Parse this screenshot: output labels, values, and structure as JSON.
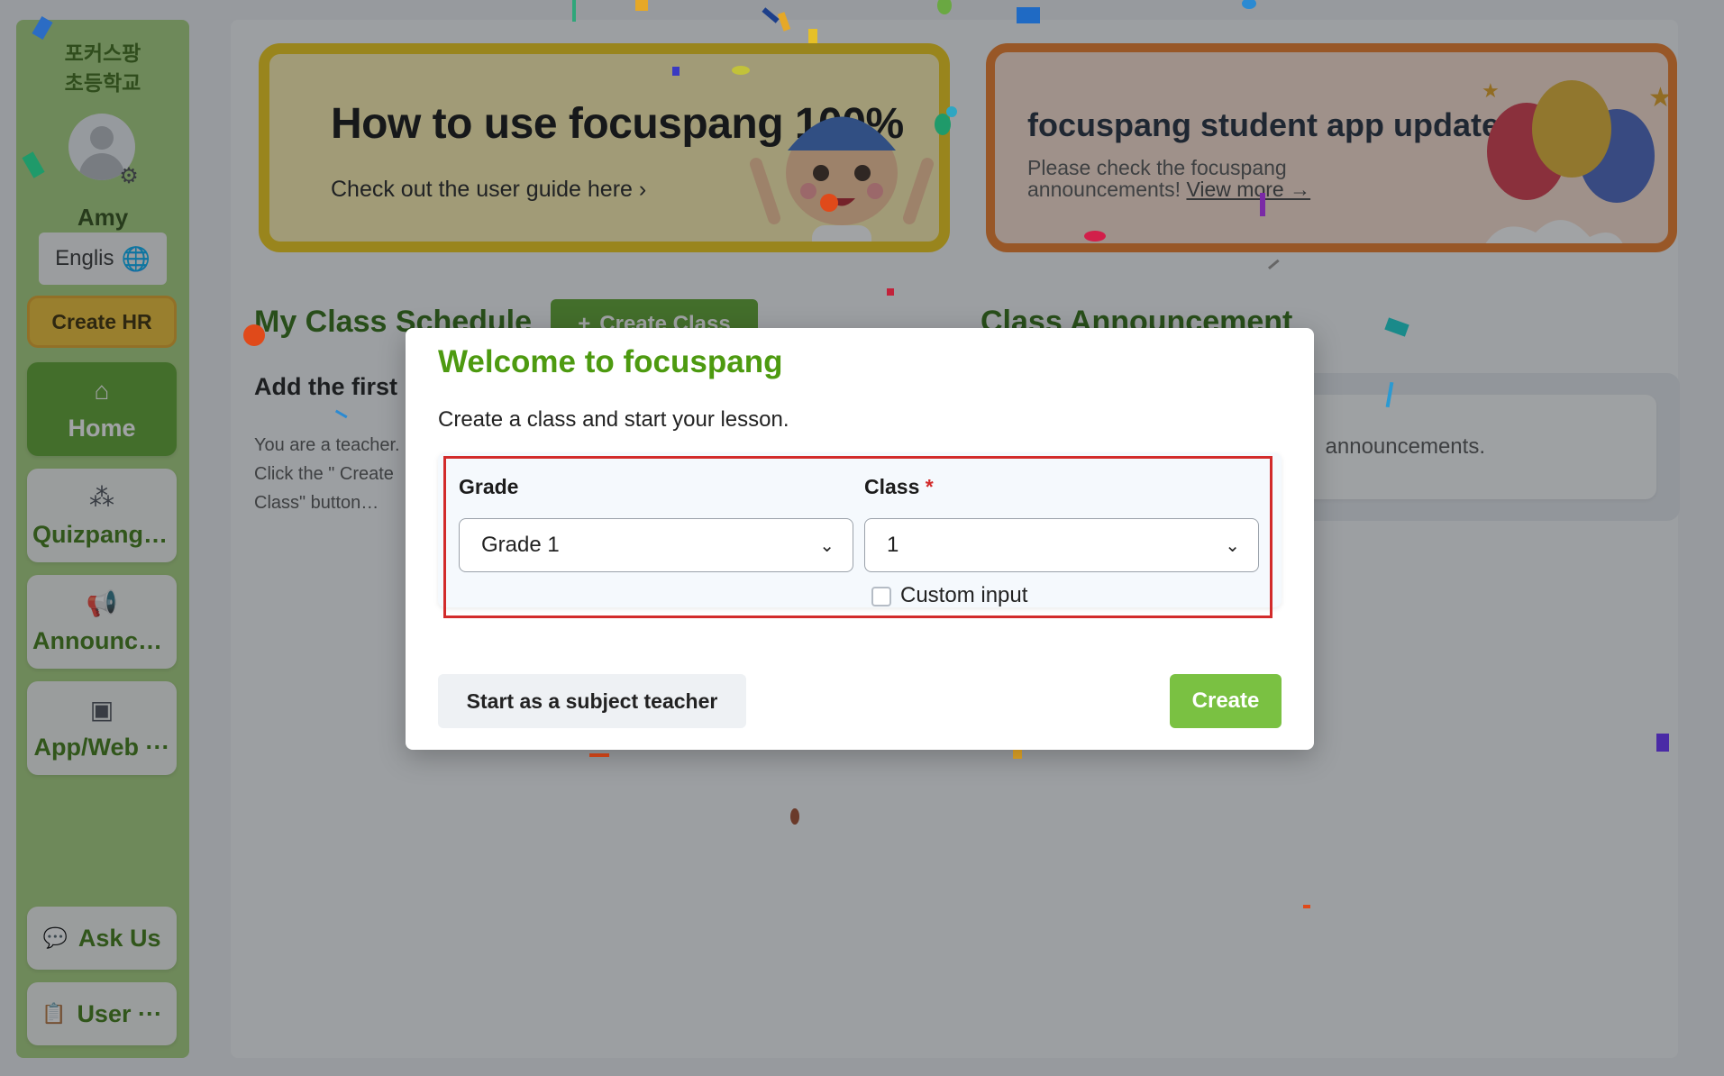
{
  "colors": {
    "brand_green": "#5ea42d",
    "sidebar_green": "#a8d27e",
    "accent_yellow": "#f1c232",
    "accent_orange": "#f07c26",
    "required_red": "#d22b2b",
    "create_green": "#7ac142"
  },
  "sidebar": {
    "school_name": "포커스팡\n초등학교",
    "user_name": "Amy",
    "avatar_icon": "user-avatar-icon",
    "settings_icon": "gear-icon",
    "language_label": "Englis",
    "language_icon": "globe-icon",
    "create_hr_label": "Create HR",
    "nav": [
      {
        "label": "Home",
        "icon": "home-icon",
        "active": true
      },
      {
        "label": "Quizpang ···",
        "icon": "quiz-icon",
        "active": false
      },
      {
        "label": "Announce···",
        "icon": "megaphone-icon",
        "active": false
      },
      {
        "label": "App/Web ···",
        "icon": "app-settings-icon",
        "active": false
      }
    ],
    "ask_us_label": "Ask Us",
    "ask_us_icon": "chat-icon",
    "user_label": "User ···",
    "user_icon": "clipboard-icon"
  },
  "banners": {
    "guide": {
      "title": "How to use focuspang 100%",
      "subtitle": "Check out the user guide here",
      "chevron": "›"
    },
    "update": {
      "title": "focuspang student app update",
      "text": "Please check the focuspang announcements!",
      "link": "View more →"
    }
  },
  "schedule": {
    "title": "My Class Schedule",
    "create_class_label": "Create Class",
    "create_class_icon": "+",
    "add_first": "Add the first",
    "teacher_text": "You are a teacher. Click the \" Create Class\" button… managed here."
  },
  "announcements": {
    "title": "Class Announcement",
    "empty_text": "announcements."
  },
  "modal": {
    "title": "Welcome to focuspang",
    "subtitle": "Create a class and start your lesson.",
    "grade_label": "Grade",
    "grade_value": "Grade 1",
    "class_label": "Class",
    "class_required": "*",
    "class_value": "1",
    "custom_input_label": "Custom input",
    "custom_input_checked": false,
    "subject_teacher_label": "Start as a subject teacher",
    "create_label": "Create"
  }
}
